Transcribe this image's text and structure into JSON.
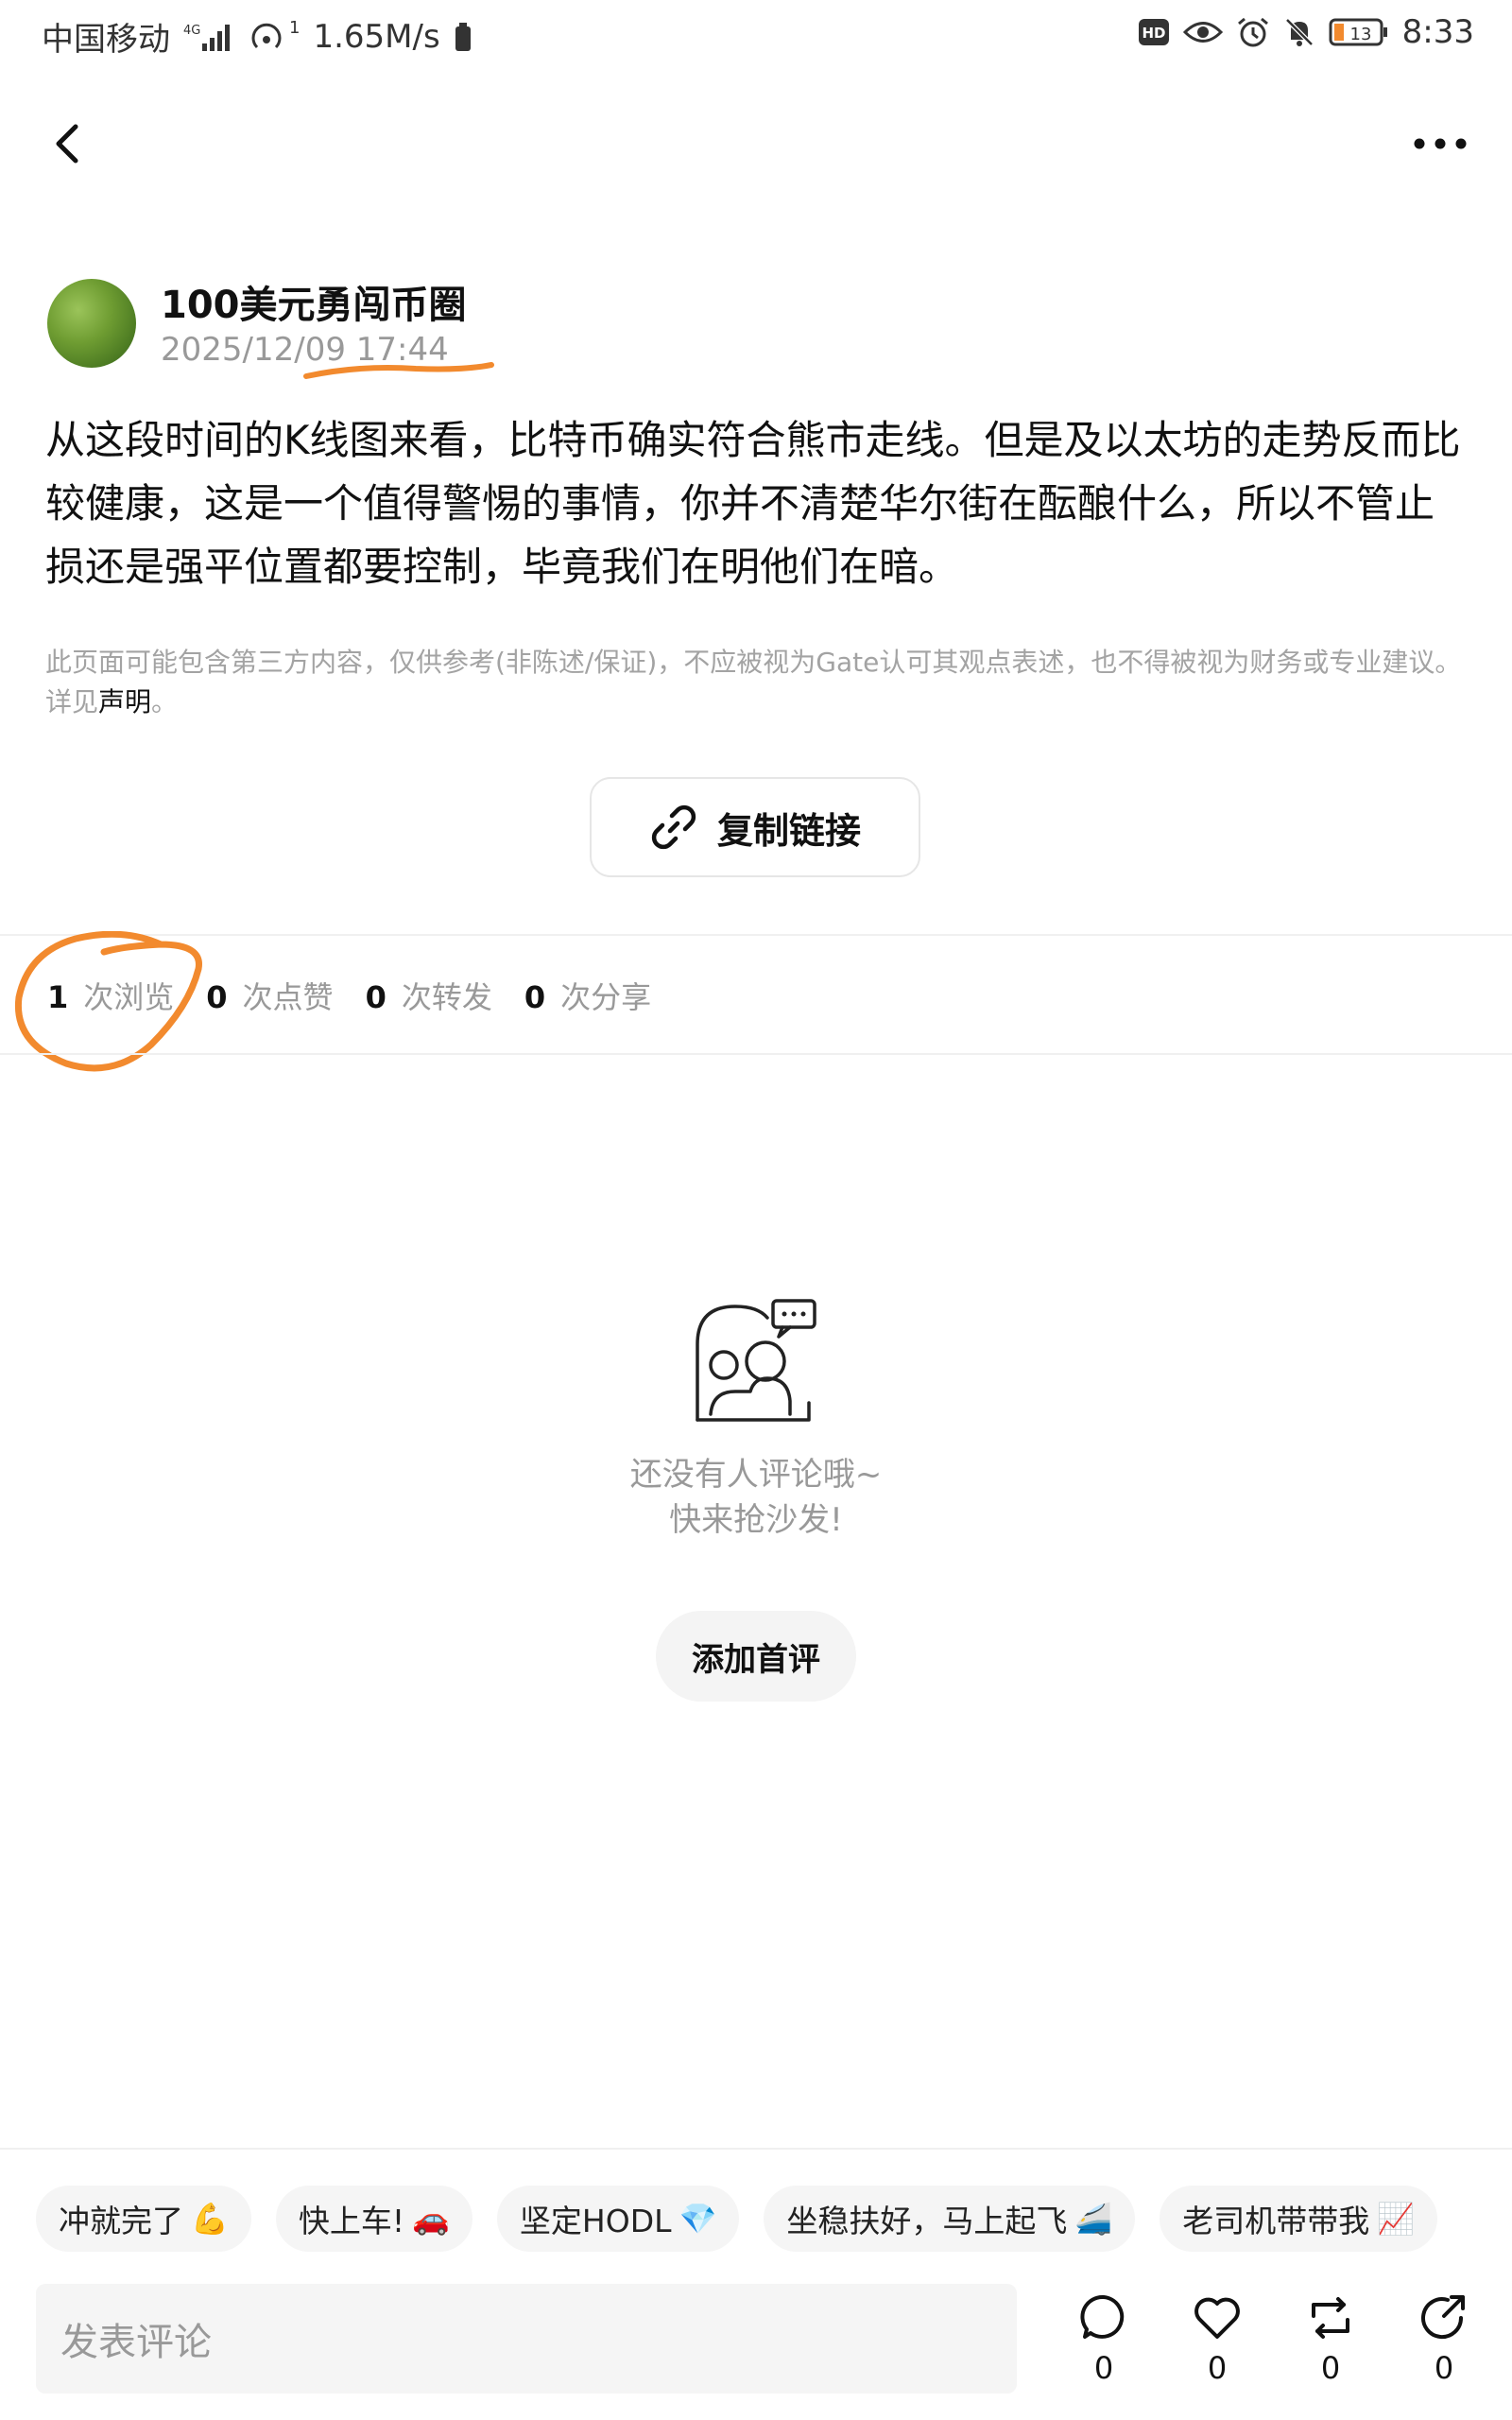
{
  "status_bar": {
    "carrier": "中国移动",
    "network": "4G",
    "hotspot_badge": "1",
    "speed": "1.65M/s",
    "hd_label": "HD",
    "battery": "13",
    "time": "8:33"
  },
  "post": {
    "author": "100美元勇闯币圈",
    "timestamp": "2025/12/09 17:44",
    "body": "从这段时间的K线图来看，比特币确实符合熊市走线。但是及以太坊的走势反而比较健康，这是一个值得警惕的事情，你并不清楚华尔街在酝酿什么，所以不管止损还是强平位置都要控制，毕竟我们在明他们在暗。",
    "disclaimer": "此页面可能包含第三方内容，仅供参考(非陈述/保证)，不应被视为Gate认可其观点表述，也不得被视为财务或专业建议。详见",
    "disclaimer_link": "声明",
    "disclaimer_end": "。"
  },
  "copy_link_label": "复制链接",
  "stats": [
    {
      "count": "1",
      "label": "次浏览"
    },
    {
      "count": "0",
      "label": "次点赞"
    },
    {
      "count": "0",
      "label": "次转发"
    },
    {
      "count": "0",
      "label": "次分享"
    }
  ],
  "empty_state": {
    "line1": "还没有人评论哦~",
    "line2": "快来抢沙发!",
    "button": "添加首评"
  },
  "quick_replies": [
    {
      "text": "冲就完了",
      "emoji": "💪"
    },
    {
      "text": "快上车!",
      "emoji": "🚗"
    },
    {
      "text": "坚定HODL",
      "emoji": "💎"
    },
    {
      "text": "坐稳扶好，马上起飞",
      "emoji": "🚄"
    },
    {
      "text": "老司机带带我",
      "emoji": "📈"
    }
  ],
  "comment_placeholder": "发表评论",
  "actions": {
    "comment_count": "0",
    "like_count": "0",
    "repost_count": "0",
    "share_count": "0"
  },
  "colors": {
    "annotation": "#F28A2E",
    "muted_text": "#999999",
    "chip_bg": "#F5F5F5"
  }
}
